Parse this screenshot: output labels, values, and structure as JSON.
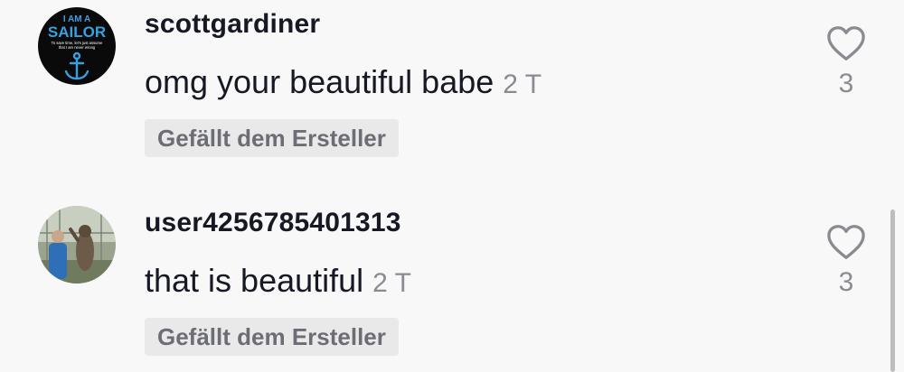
{
  "comments": [
    {
      "username": "scottgardiner",
      "text": "omg your beautiful babe",
      "time": "2 T",
      "badge": "Gefällt dem Ersteller",
      "likes": "3",
      "avatar": {
        "line1": "I AM A",
        "line2": "SAILOR",
        "line3": "To save time, let's just assume",
        "line4": "that I am never wrong",
        "icon": "anchor-icon",
        "bg_color": "#0a0a0a",
        "accent_color": "#3aa0e0"
      }
    },
    {
      "username": "user4256785401313",
      "text": "that is beautiful",
      "time": "2 T",
      "badge": "Gefällt dem Ersteller",
      "likes": "3",
      "avatar": {
        "icon": "photo-avatar"
      }
    }
  ],
  "like_icon": "heart-outline-icon"
}
